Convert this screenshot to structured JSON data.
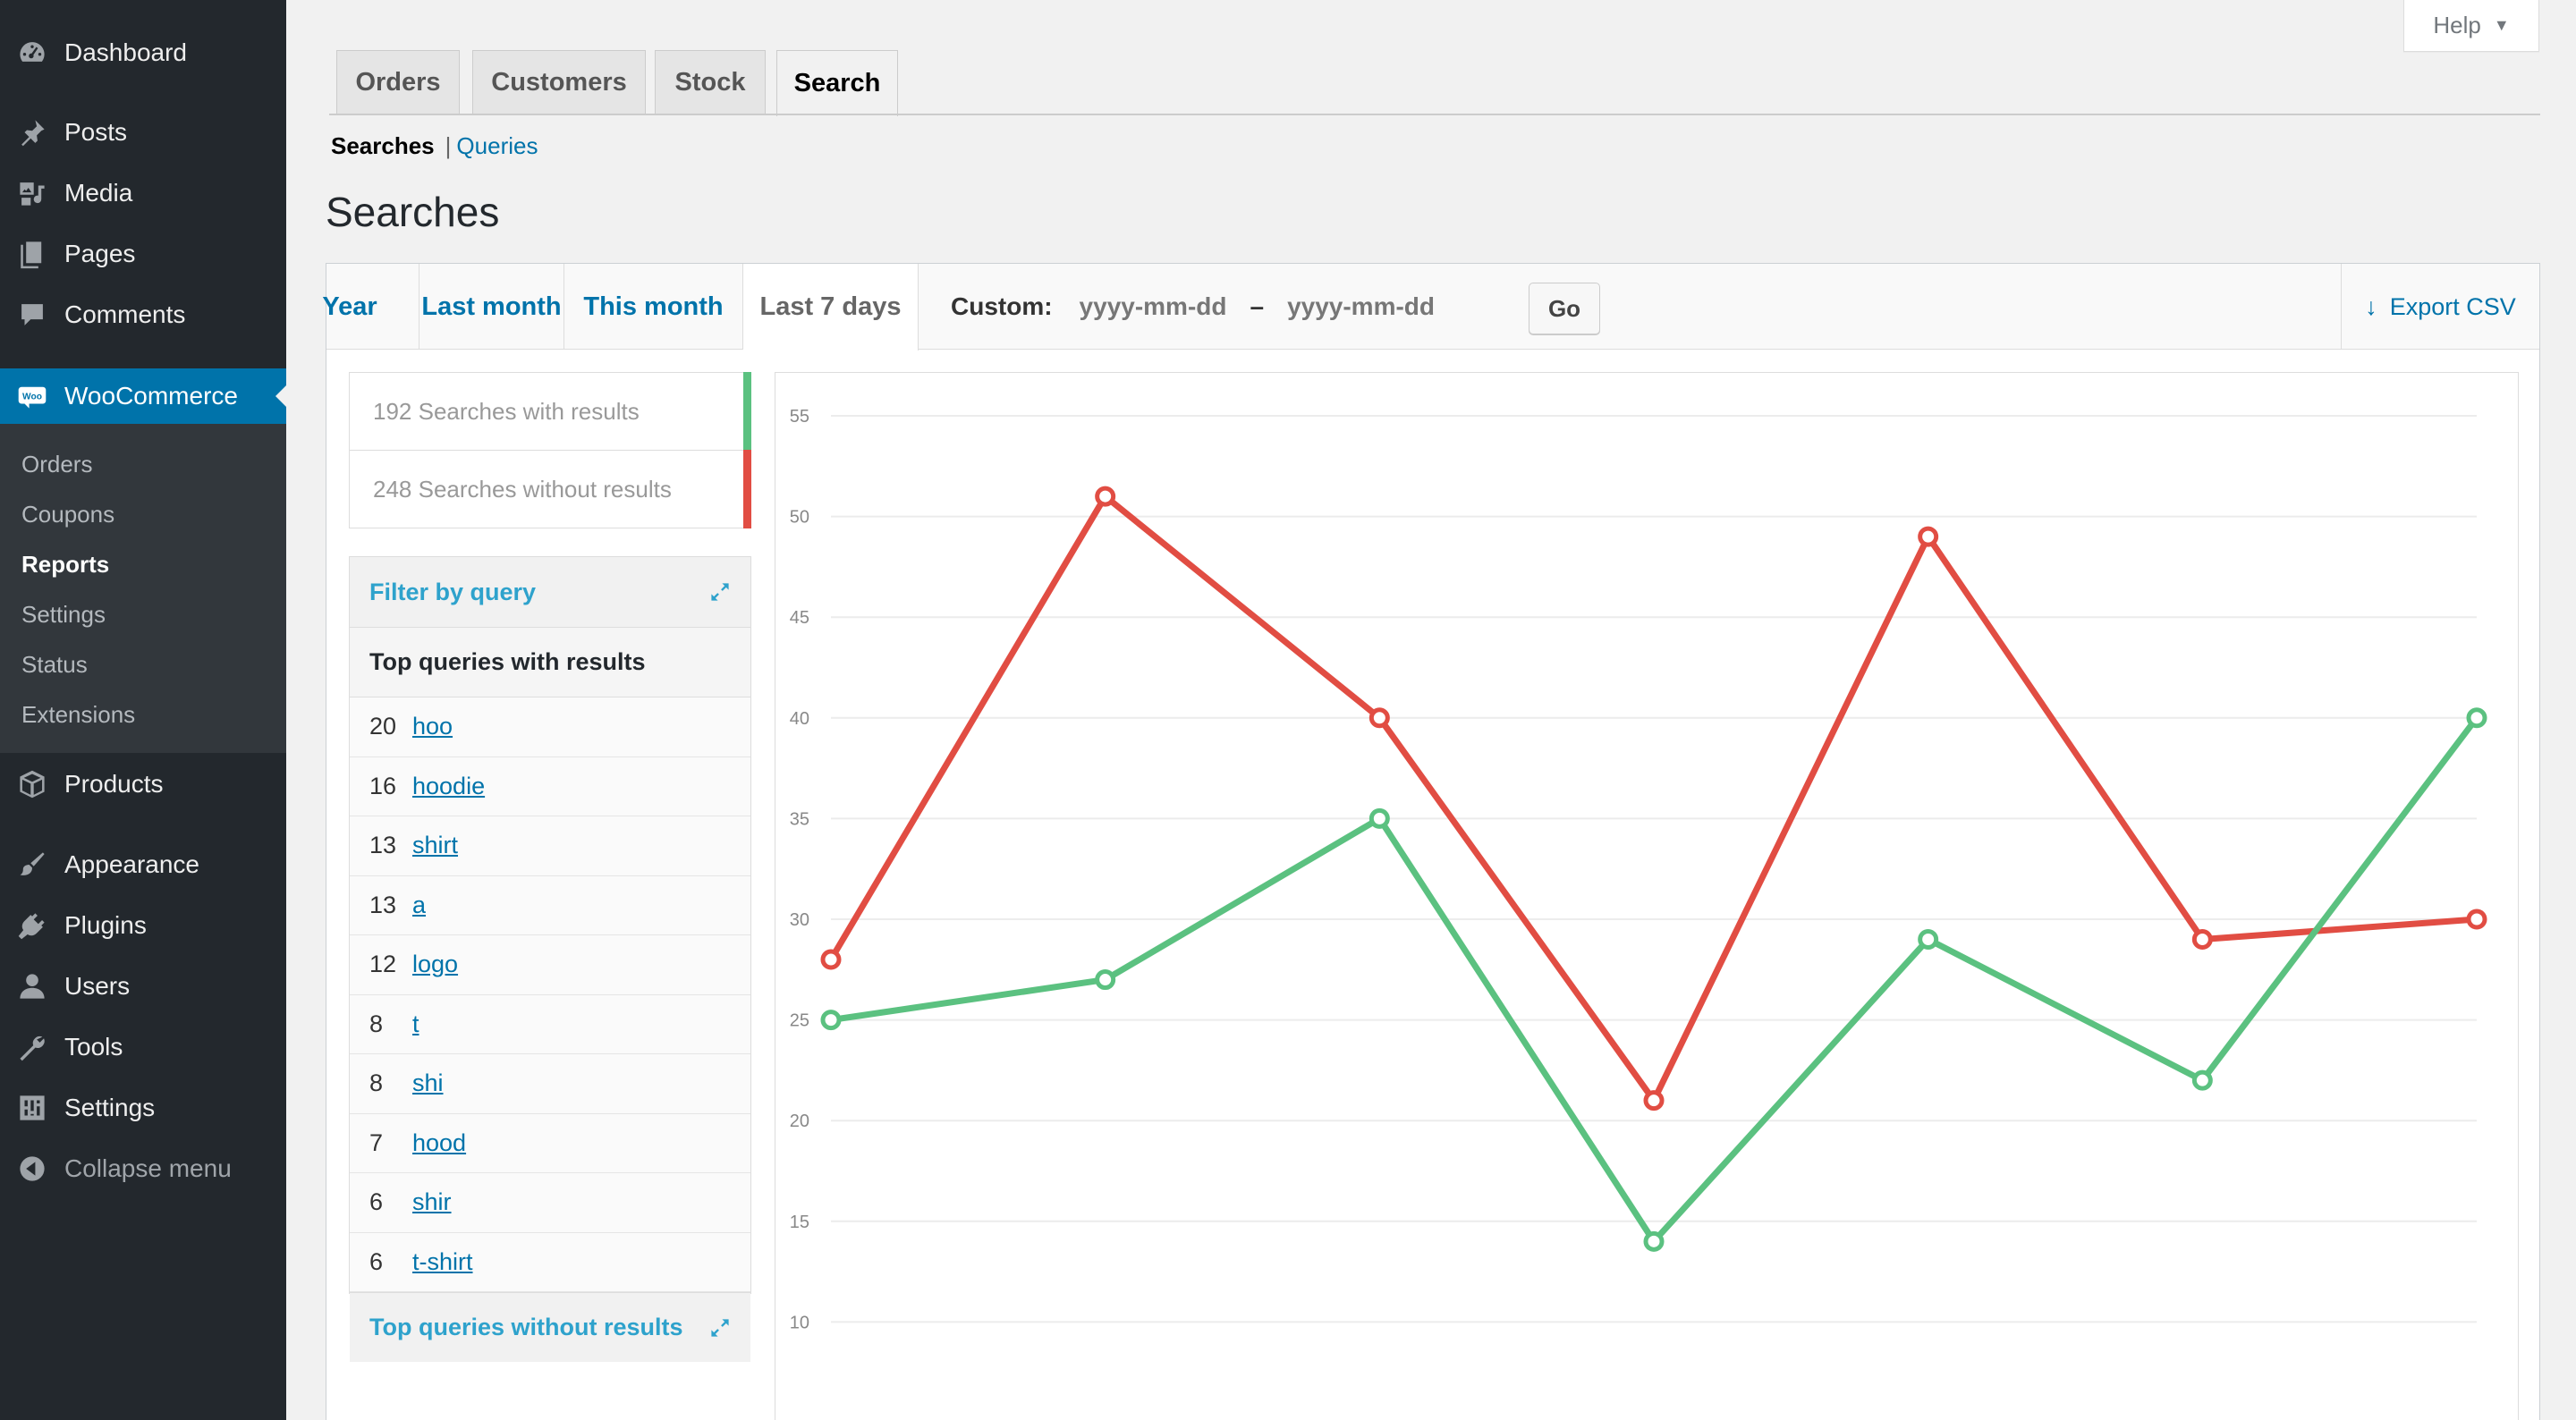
{
  "sidebar": {
    "items": [
      {
        "label": "Dashboard",
        "icon": "dashboard-icon"
      },
      {
        "label": "Posts",
        "icon": "pin-icon"
      },
      {
        "label": "Media",
        "icon": "media-icon"
      },
      {
        "label": "Pages",
        "icon": "pages-icon"
      },
      {
        "label": "Comments",
        "icon": "comment-icon"
      },
      {
        "label": "WooCommerce",
        "icon": "woo-icon"
      },
      {
        "label": "Products",
        "icon": "box-icon"
      },
      {
        "label": "Appearance",
        "icon": "brush-icon"
      },
      {
        "label": "Plugins",
        "icon": "plug-icon"
      },
      {
        "label": "Users",
        "icon": "user-icon"
      },
      {
        "label": "Tools",
        "icon": "wrench-icon"
      },
      {
        "label": "Settings",
        "icon": "settings-icon"
      },
      {
        "label": "Collapse menu",
        "icon": "collapse-icon"
      }
    ],
    "woo_icon_text": "Woo",
    "submenu": [
      "Orders",
      "Coupons",
      "Reports",
      "Settings",
      "Status",
      "Extensions"
    ]
  },
  "help": {
    "label": "Help",
    "caret": "▼"
  },
  "tabs": [
    "Orders",
    "Customers",
    "Stock",
    "Search"
  ],
  "subsub": {
    "current": "Searches",
    "separator": "|",
    "link": "Queries"
  },
  "page_title": "Searches",
  "ranges": [
    "Year",
    "Last month",
    "This month",
    "Last 7 days"
  ],
  "custom": {
    "label": "Custom:",
    "placeholder_from": "yyyy-mm-dd",
    "dash": "–",
    "placeholder_to": "yyyy-mm-dd",
    "go": "Go"
  },
  "export": {
    "label": "Export CSV",
    "arrow": "↓"
  },
  "legend": {
    "with_results": "192 Searches with results",
    "without_results": "248 Searches without results",
    "green": "#5bc180",
    "red": "#e14d43"
  },
  "filter": {
    "label": "Filter by query"
  },
  "top_queries": {
    "title": "Top queries with results",
    "rows": [
      {
        "count": "20",
        "query": "hoo"
      },
      {
        "count": "16",
        "query": "hoodie"
      },
      {
        "count": "13",
        "query": "shirt"
      },
      {
        "count": "13",
        "query": "a"
      },
      {
        "count": "12",
        "query": "logo"
      },
      {
        "count": "8",
        "query": "t"
      },
      {
        "count": "8",
        "query": "shi"
      },
      {
        "count": "7",
        "query": "hood"
      },
      {
        "count": "6",
        "query": "shir"
      },
      {
        "count": "6",
        "query": "t-shirt"
      }
    ]
  },
  "top_without": {
    "label": "Top queries without results"
  },
  "chart_data": {
    "type": "line",
    "yticks": [
      10,
      15,
      20,
      25,
      30,
      35,
      40,
      45,
      50,
      55
    ],
    "ylim": [
      5,
      55
    ],
    "grid": true,
    "series": [
      {
        "color": "#e14d43",
        "values": [
          28,
          51,
          40,
          21,
          49,
          29,
          30
        ]
      },
      {
        "color": "#5bc180",
        "values": [
          25,
          27,
          35,
          14,
          29,
          22,
          40
        ]
      }
    ]
  }
}
